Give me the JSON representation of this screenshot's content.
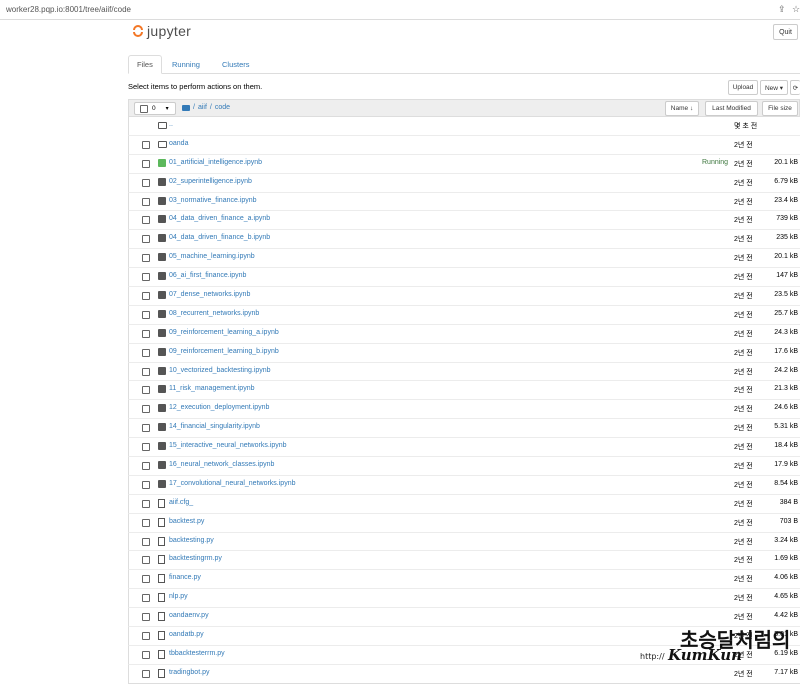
{
  "browser": {
    "url": "worker28.pqp.io:8001/tree/aiif/code"
  },
  "header": {
    "logo_text": "jupyter",
    "quit_label": "Quit"
  },
  "tabs": [
    {
      "label": "Files",
      "active": true
    },
    {
      "label": "Running",
      "active": false
    },
    {
      "label": "Clusters",
      "active": false
    }
  ],
  "toolbar": {
    "hint": "Select items to perform actions on them.",
    "upload_label": "Upload",
    "new_label": "New ▾",
    "refresh_icon": "refresh-icon"
  },
  "list_header": {
    "selected_count": "0",
    "breadcrumb": [
      "/",
      "aiif",
      "/",
      "code"
    ],
    "name_label": "Name ↓",
    "last_modified_label": "Last Modified",
    "file_size_label": "File size"
  },
  "items": [
    {
      "type": "folder",
      "name": "..",
      "modified": "몇 초 전",
      "size": "",
      "running": ""
    },
    {
      "type": "folder",
      "name": "oanda",
      "modified": "2년 전",
      "size": "",
      "running": ""
    },
    {
      "type": "notebook-running",
      "name": "01_artificial_intelligence.ipynb",
      "modified": "2년 전",
      "size": "20.1 kB",
      "running": "Running"
    },
    {
      "type": "notebook",
      "name": "02_superintelligence.ipynb",
      "modified": "2년 전",
      "size": "6.79 kB",
      "running": ""
    },
    {
      "type": "notebook",
      "name": "03_normative_finance.ipynb",
      "modified": "2년 전",
      "size": "23.4 kB",
      "running": ""
    },
    {
      "type": "notebook",
      "name": "04_data_driven_finance_a.ipynb",
      "modified": "2년 전",
      "size": "739 kB",
      "running": ""
    },
    {
      "type": "notebook",
      "name": "04_data_driven_finance_b.ipynb",
      "modified": "2년 전",
      "size": "235 kB",
      "running": ""
    },
    {
      "type": "notebook",
      "name": "05_machine_learning.ipynb",
      "modified": "2년 전",
      "size": "20.1 kB",
      "running": ""
    },
    {
      "type": "notebook",
      "name": "06_ai_first_finance.ipynb",
      "modified": "2년 전",
      "size": "147 kB",
      "running": ""
    },
    {
      "type": "notebook",
      "name": "07_dense_networks.ipynb",
      "modified": "2년 전",
      "size": "23.5 kB",
      "running": ""
    },
    {
      "type": "notebook",
      "name": "08_recurrent_networks.ipynb",
      "modified": "2년 전",
      "size": "25.7 kB",
      "running": ""
    },
    {
      "type": "notebook",
      "name": "09_reinforcement_learning_a.ipynb",
      "modified": "2년 전",
      "size": "24.3 kB",
      "running": ""
    },
    {
      "type": "notebook",
      "name": "09_reinforcement_learning_b.ipynb",
      "modified": "2년 전",
      "size": "17.6 kB",
      "running": ""
    },
    {
      "type": "notebook",
      "name": "10_vectorized_backtesting.ipynb",
      "modified": "2년 전",
      "size": "24.2 kB",
      "running": ""
    },
    {
      "type": "notebook",
      "name": "11_risk_management.ipynb",
      "modified": "2년 전",
      "size": "21.3 kB",
      "running": ""
    },
    {
      "type": "notebook",
      "name": "12_execution_deployment.ipynb",
      "modified": "2년 전",
      "size": "24.6 kB",
      "running": ""
    },
    {
      "type": "notebook",
      "name": "14_financial_singularity.ipynb",
      "modified": "2년 전",
      "size": "5.31 kB",
      "running": ""
    },
    {
      "type": "notebook",
      "name": "15_interactive_neural_networks.ipynb",
      "modified": "2년 전",
      "size": "18.4 kB",
      "running": ""
    },
    {
      "type": "notebook",
      "name": "16_neural_network_classes.ipynb",
      "modified": "2년 전",
      "size": "17.9 kB",
      "running": ""
    },
    {
      "type": "notebook",
      "name": "17_convolutional_neural_networks.ipynb",
      "modified": "2년 전",
      "size": "8.54 kB",
      "running": ""
    },
    {
      "type": "file",
      "name": "aiif.cfg_",
      "modified": "2년 전",
      "size": "384 B",
      "running": ""
    },
    {
      "type": "file",
      "name": "backtest.py",
      "modified": "2년 전",
      "size": "703 B",
      "running": ""
    },
    {
      "type": "file",
      "name": "backtesting.py",
      "modified": "2년 전",
      "size": "3.24 kB",
      "running": ""
    },
    {
      "type": "file",
      "name": "backtestingrm.py",
      "modified": "2년 전",
      "size": "1.69 kB",
      "running": ""
    },
    {
      "type": "file",
      "name": "finance.py",
      "modified": "2년 전",
      "size": "4.06 kB",
      "running": ""
    },
    {
      "type": "file",
      "name": "nlp.py",
      "modified": "2년 전",
      "size": "4.65 kB",
      "running": ""
    },
    {
      "type": "file",
      "name": "oandaenv.py",
      "modified": "2년 전",
      "size": "4.42 kB",
      "running": ""
    },
    {
      "type": "file",
      "name": "oandatb.py",
      "modified": "2년 전",
      "size": "5.01 kB",
      "running": ""
    },
    {
      "type": "file",
      "name": "tbbacktesterrm.py",
      "modified": "2년 전",
      "size": "6.19 kB",
      "running": ""
    },
    {
      "type": "file",
      "name": "tradingbot.py",
      "modified": "2년 전",
      "size": "7.17 kB",
      "running": ""
    }
  ],
  "watermark": {
    "main": "초승달처럼의",
    "brand": "KumKun",
    "sub": "http://"
  },
  "colors": {
    "link": "#337ab7",
    "running": "#3c763d",
    "logo_orange": "#f37726"
  }
}
